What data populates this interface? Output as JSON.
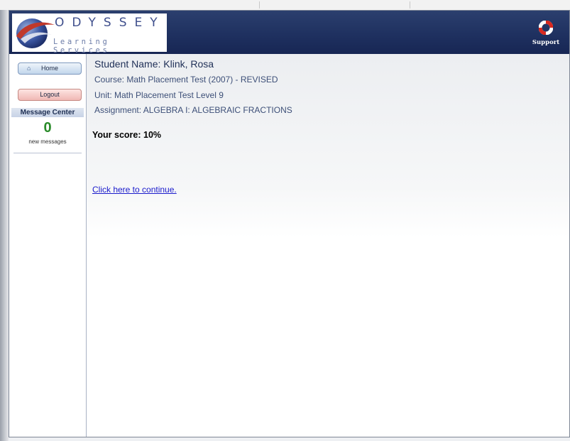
{
  "header": {
    "logo_word": "ODYSSEY",
    "logo_sub": "Learning Services",
    "support_label": "Support",
    "colors": {
      "header_bg": "#1f3160",
      "logo_text": "#3f4f8c"
    }
  },
  "sidebar": {
    "home_label": "Home",
    "logout_label": "Logout",
    "message_center_title": "Message Center",
    "message_count": "0",
    "message_label": "new messages",
    "colors": {
      "count": "#2a8b2a",
      "home_button": "#c2d6ec",
      "logout_button": "#f0b8b4"
    }
  },
  "main": {
    "student_name": "Student Name: Klink, Rosa",
    "course": "Course: Math Placement Test (2007) - REVISED",
    "unit": "Unit: Math Placement Test Level 9",
    "assignment": "Assignment: ALGEBRA I: ALGEBRAIC FRACTIONS",
    "score": "Your score: 10%",
    "continue_link": "Click here to continue.",
    "colors": {
      "link": "#1a1acc"
    }
  },
  "icons": {
    "logo": "odyssey-swirl-icon",
    "support": "lifebuoy-icon",
    "home": "house-icon"
  }
}
